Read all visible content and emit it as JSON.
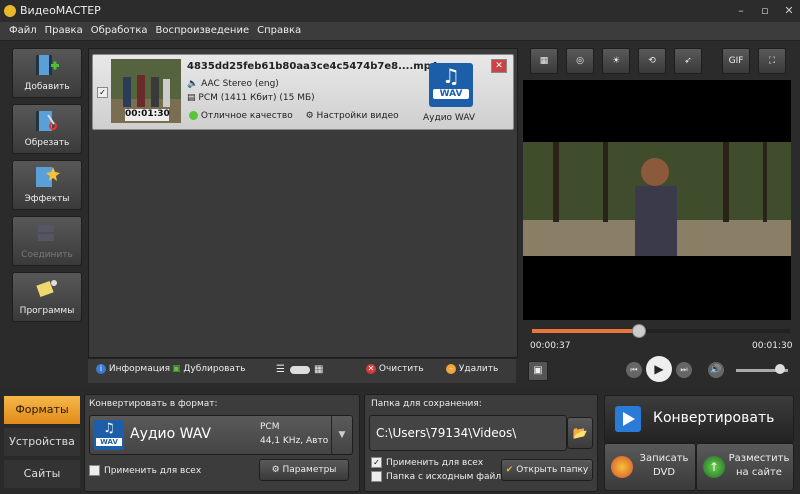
{
  "window": {
    "title": "ВидеоМАСТЕР"
  },
  "menu": [
    "Файл",
    "Правка",
    "Обработка",
    "Воспроизведение",
    "Справка"
  ],
  "left_toolbar": [
    {
      "label": "Добавить",
      "icon": "film-add-icon"
    },
    {
      "label": "Обрезать",
      "icon": "film-cut-icon"
    },
    {
      "label": "Эффекты",
      "icon": "magic-wand-icon"
    },
    {
      "label": "Соединить",
      "icon": "join-icon",
      "disabled": true
    },
    {
      "label": "Программы",
      "icon": "programs-icon"
    }
  ],
  "file": {
    "name": "4835dd25feb61b80aa3ce4c5474b7e8....mp4",
    "audio": "AAC Stereo (eng)",
    "codec": "PCM (1411 Кбит) (15 МБ)",
    "quality": "Отличное качество",
    "video_settings": "Настройки видео",
    "duration": "00:01:30",
    "format_label": "Аудио WAV",
    "format_badge": "WAV",
    "checked": true
  },
  "list_bar": {
    "info": "Информация",
    "duplicate": "Дублировать",
    "clear": "Очистить",
    "delete": "Удалить"
  },
  "preview_tools": [
    "crop-icon",
    "target-icon",
    "brightness-icon",
    "rotate-icon",
    "speed-icon",
    "GIF",
    "fullscreen-icon"
  ],
  "player": {
    "current": "00:00:37",
    "total": "00:01:30",
    "progress": 0.41,
    "volume": 0.85
  },
  "tabs": [
    "Форматы",
    "Устройства",
    "Сайты"
  ],
  "convert_format": {
    "title": "Конвертировать в формат:",
    "value": "Аудио WAV",
    "badge": "WAV",
    "codec": "PCM",
    "details": "44,1 KHz, Авто",
    "apply_all": "Применить для всех",
    "params": "Параметры"
  },
  "save_folder": {
    "title": "Папка для сохранения:",
    "path": "C:\\Users\\79134\\Videos\\",
    "apply_all": "Применить для всех",
    "source_folder": "Папка с исходным файлом",
    "open_folder": "Открыть папку"
  },
  "actions": {
    "convert": "Конвертировать",
    "dvd": "Записать DVD",
    "dvd_line1": "Записать",
    "dvd_line2": "DVD",
    "web_line1": "Разместить",
    "web_line2": "на сайте"
  },
  "colors": {
    "accent": "#f0a43a",
    "wav_blue": "#1c5fa8"
  }
}
